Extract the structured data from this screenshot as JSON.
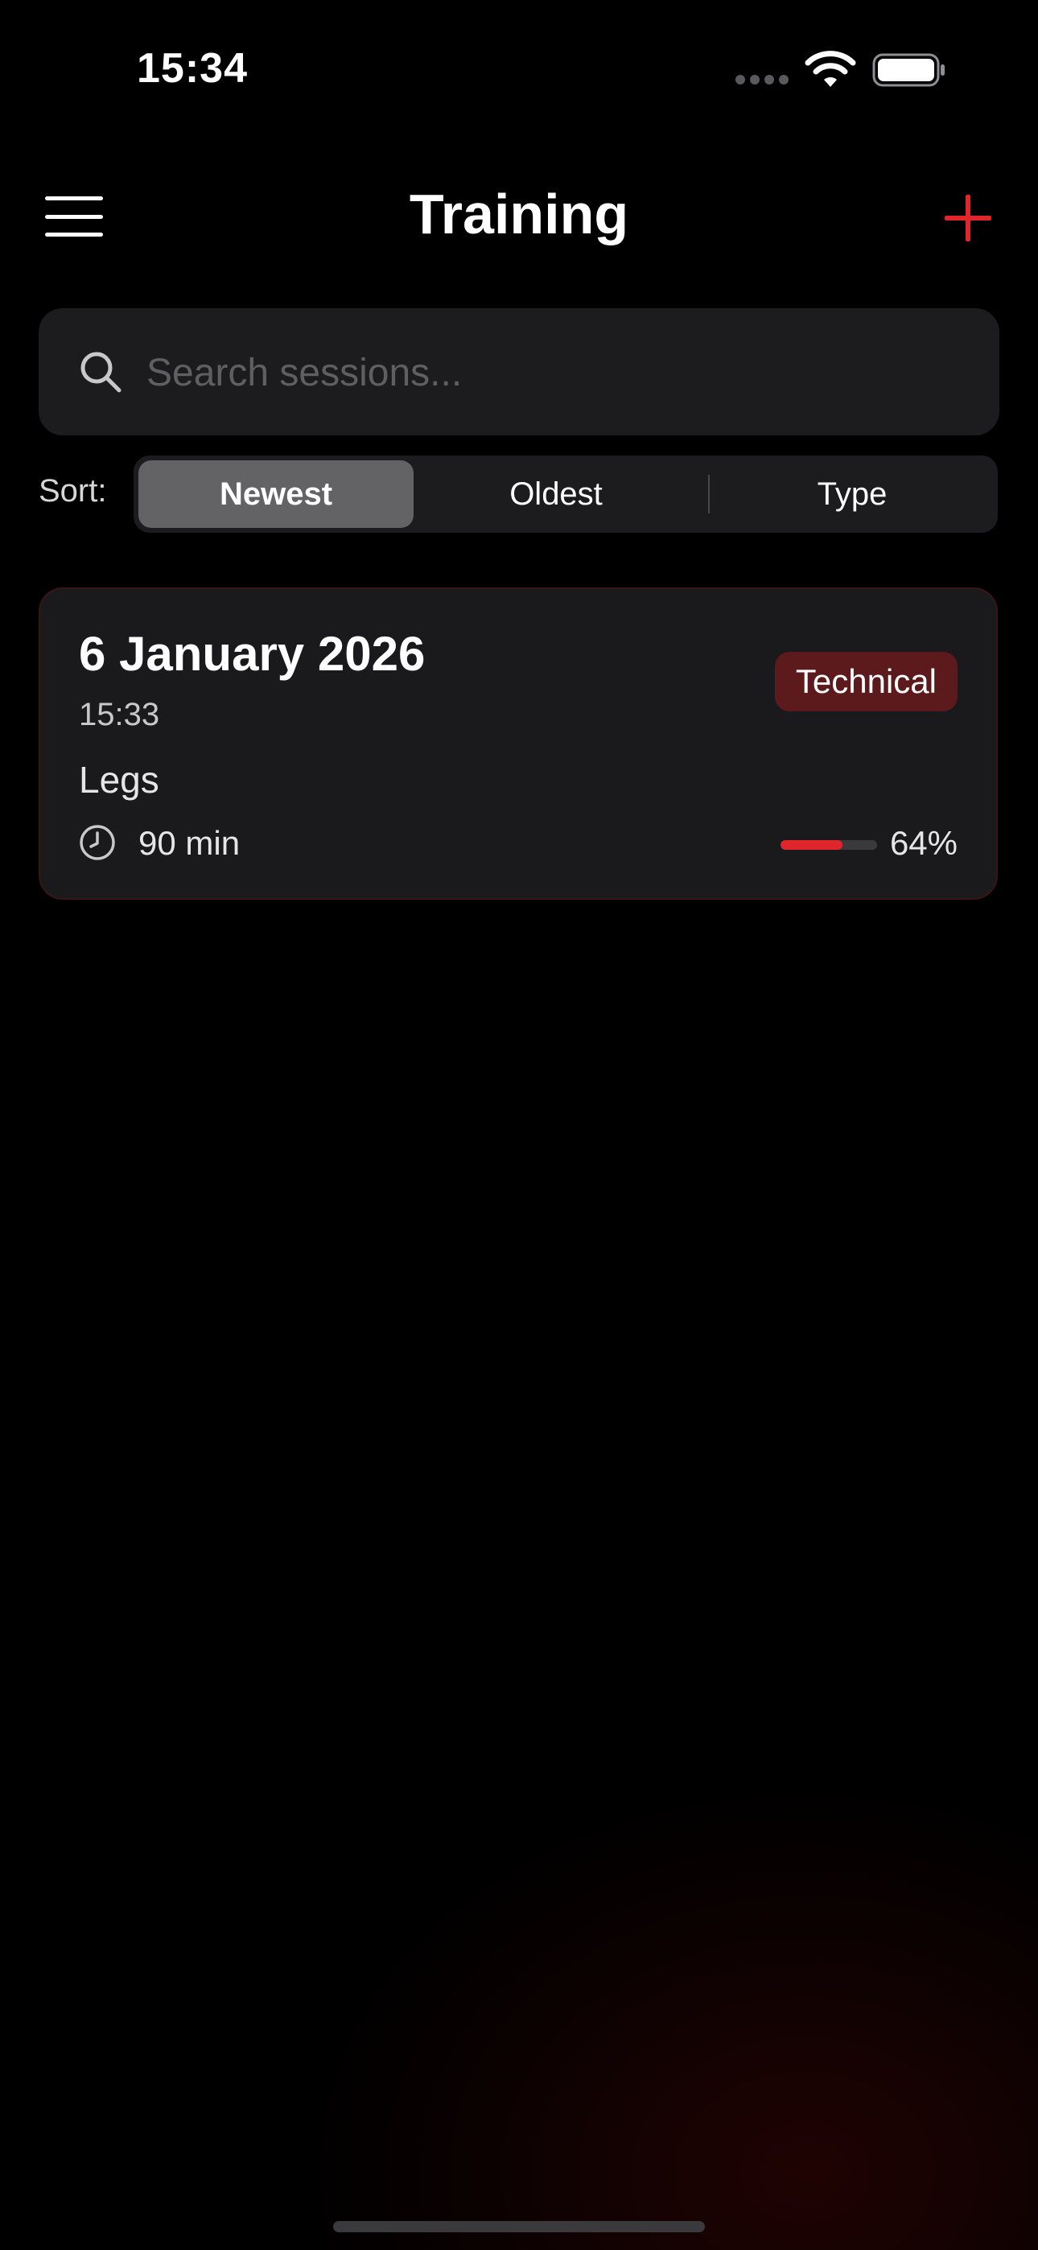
{
  "status_bar": {
    "time": "15:34"
  },
  "nav": {
    "title": "Training",
    "menu_icon": "hamburger-menu-icon",
    "add_icon": "plus-icon",
    "accent_color": "#e0262b"
  },
  "search": {
    "placeholder": "Search sessions...",
    "value": ""
  },
  "sort": {
    "label": "Sort:",
    "options": [
      "Newest",
      "Oldest",
      "Type"
    ],
    "selected": "Newest"
  },
  "sessions": [
    {
      "date": "6 January 2026",
      "time": "15:33",
      "focus": "Legs",
      "duration": "90 min",
      "type_badge": "Technical",
      "progress_percent": 64,
      "progress_label": "64%"
    }
  ]
}
